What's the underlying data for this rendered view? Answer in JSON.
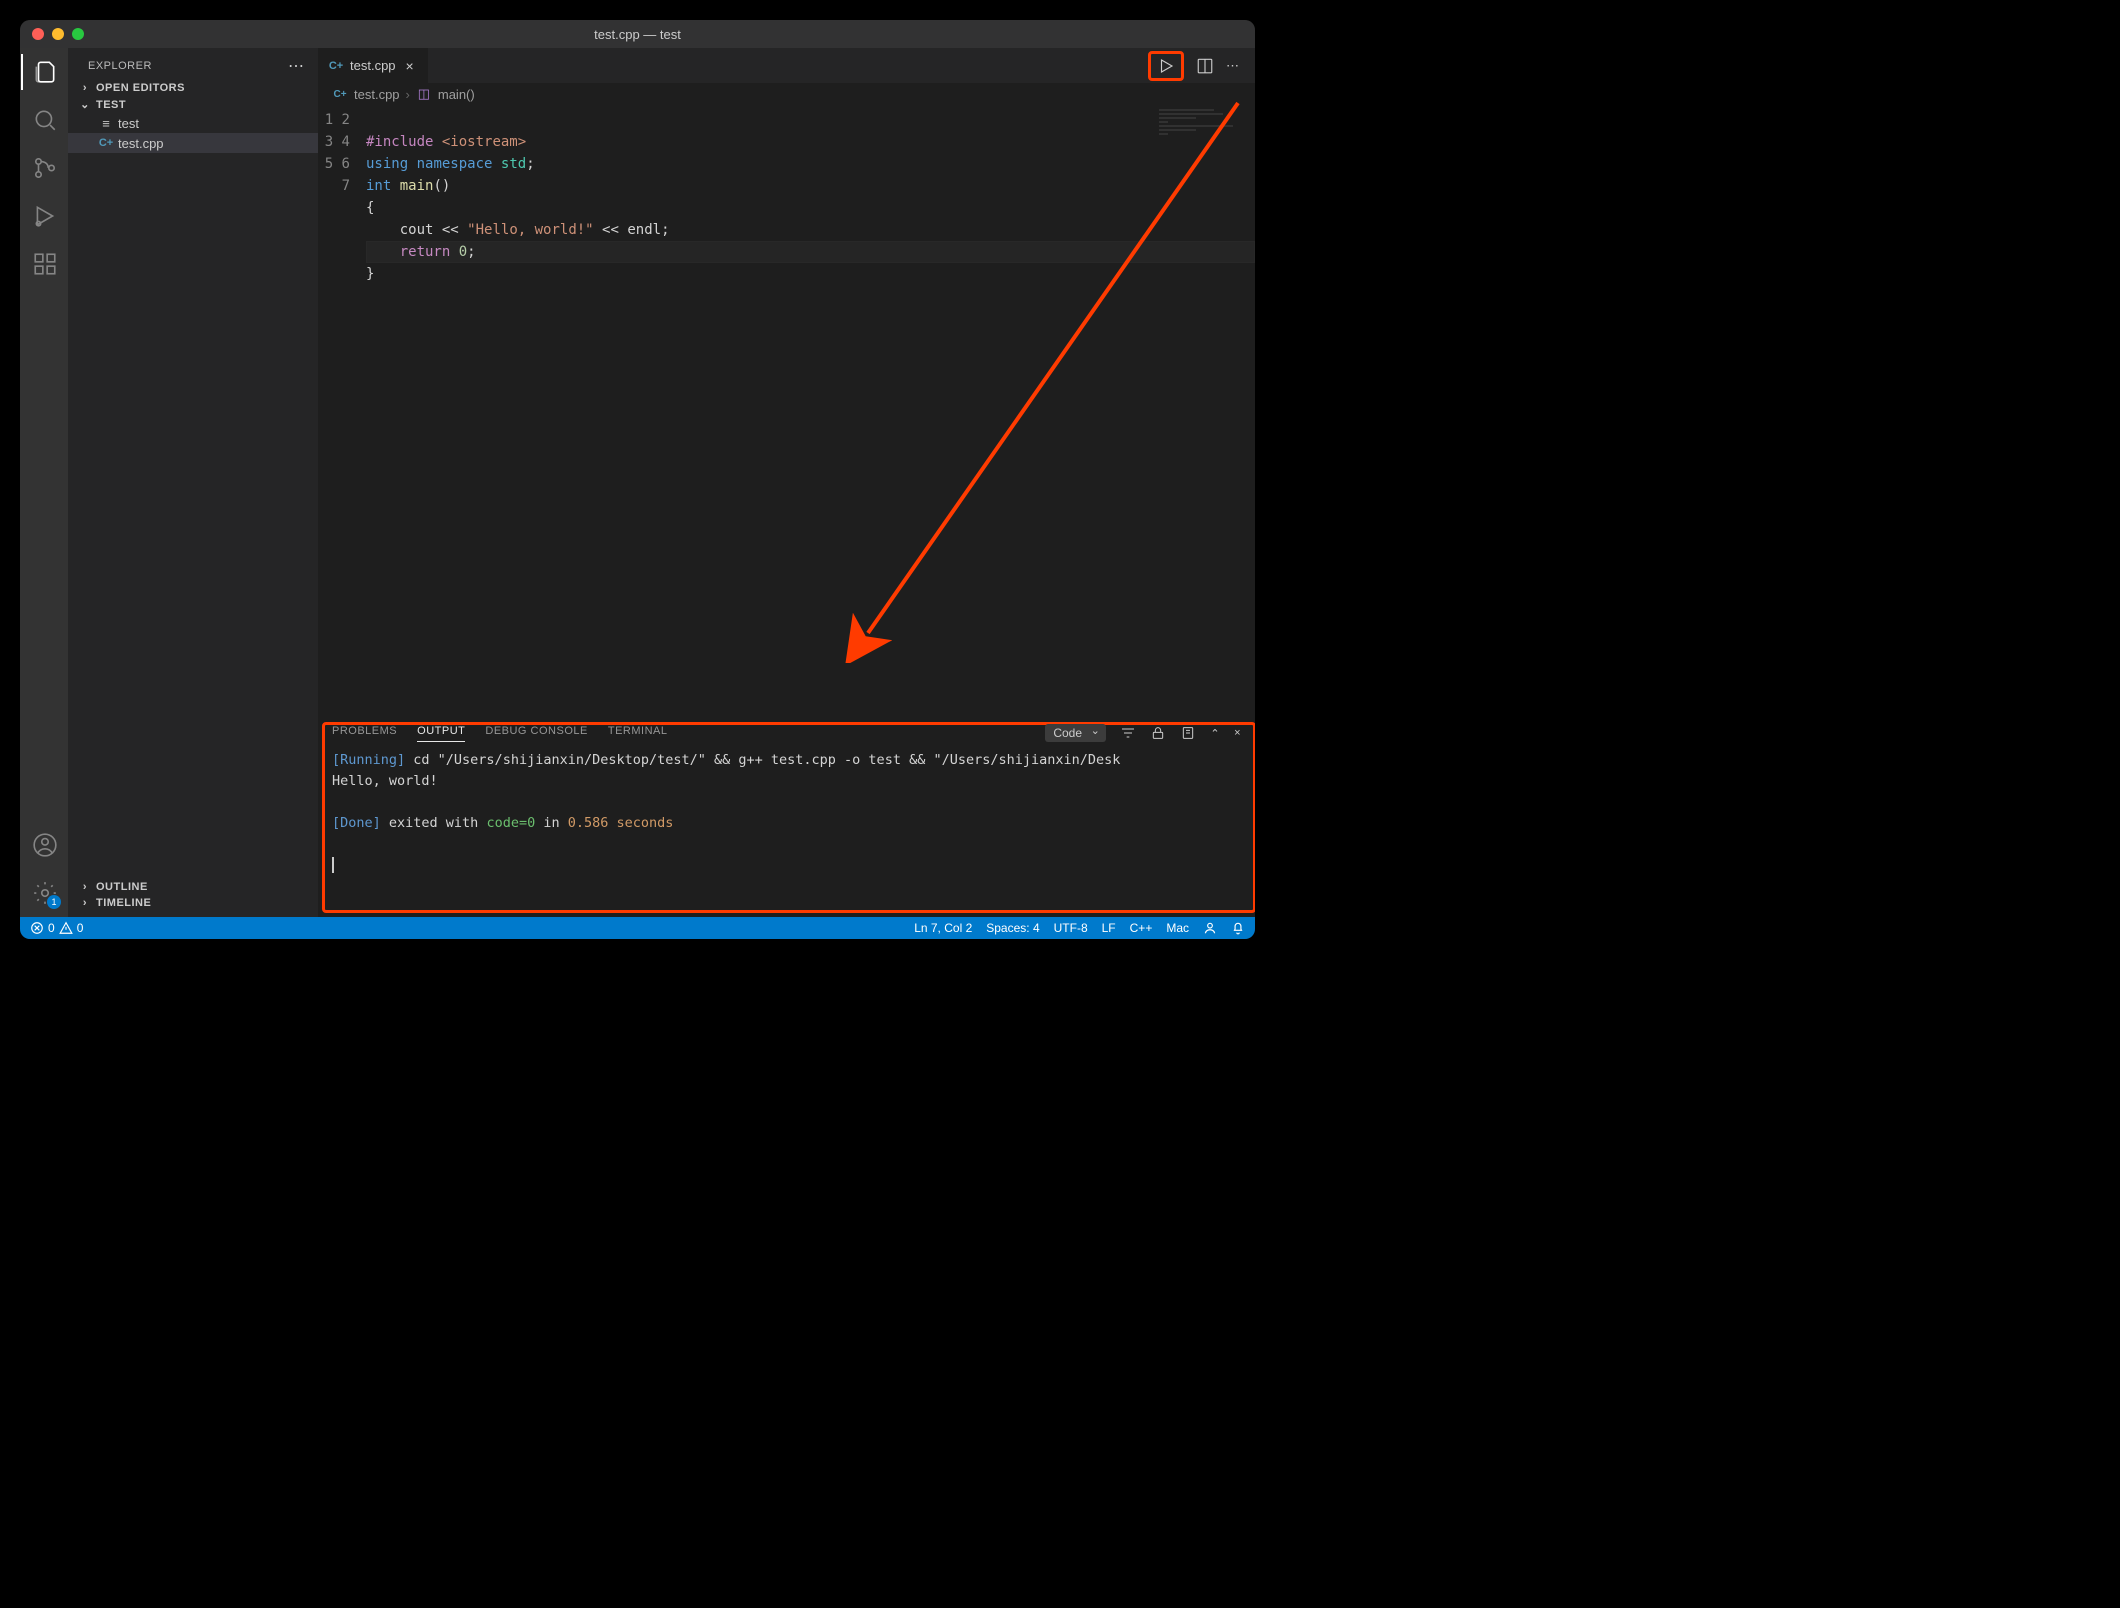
{
  "window_title": "test.cpp — test",
  "explorer": {
    "title": "EXPLORER",
    "sections": {
      "open_editors": "OPEN EDITORS",
      "folder": "TEST",
      "outline": "OUTLINE",
      "timeline": "TIMELINE"
    },
    "files": [
      {
        "name": "test",
        "icon": "file"
      },
      {
        "name": "test.cpp",
        "icon": "cpp",
        "active": true
      }
    ]
  },
  "tabs": [
    {
      "name": "test.cpp",
      "icon": "cpp"
    }
  ],
  "breadcrumb": {
    "file": "test.cpp",
    "symbol": "main()"
  },
  "code_lines": [
    1,
    2,
    3,
    4,
    5,
    6,
    7
  ],
  "code": {
    "l1a": "#include",
    "l1b": "<iostream>",
    "l2a": "using",
    "l2b": "namespace",
    "l2c": "std",
    "l2d": ";",
    "l3a": "int",
    "l3b": "main",
    "l3c": "()",
    "l4": "{",
    "l5a": "cout",
    "l5b": "<<",
    "l5c": "\"Hello, world!\"",
    "l5d": "<<",
    "l5e": "endl",
    "l5f": ";",
    "l6a": "return",
    "l6b": "0",
    "l6c": ";",
    "l7": "}"
  },
  "panel": {
    "tabs": {
      "problems": "PROBLEMS",
      "output": "OUTPUT",
      "debug": "DEBUG CONSOLE",
      "terminal": "TERMINAL"
    },
    "select": "Code",
    "output": {
      "running_tag": "[Running]",
      "running_cmd": " cd \"/Users/shijianxin/Desktop/test/\" && g++ test.cpp -o test && \"/Users/shijianxin/Desk",
      "result": "Hello, world!",
      "done_tag": "[Done]",
      "done_mid": " exited with ",
      "code_zero": "code=0",
      "done_in": " in ",
      "seconds": "0.586 seconds"
    }
  },
  "status": {
    "errors": "0",
    "warnings": "0",
    "ln_col": "Ln 7, Col 2",
    "spaces": "Spaces: 4",
    "encoding": "UTF-8",
    "eol": "LF",
    "lang": "C++",
    "os": "Mac"
  },
  "gear_badge": "1"
}
